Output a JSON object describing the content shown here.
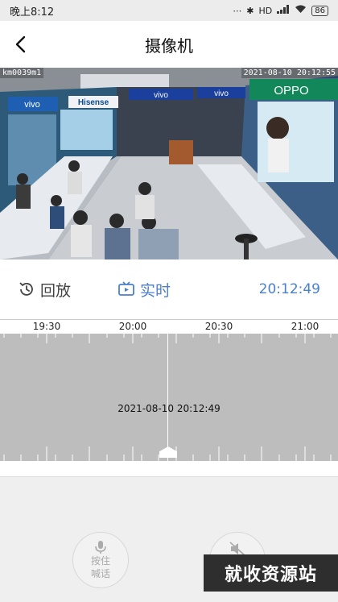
{
  "status_bar": {
    "time": "晚上8:12",
    "battery": "86",
    "network": "HD"
  },
  "header": {
    "title": "摄像机"
  },
  "video": {
    "osd_left": "km0039m1",
    "osd_right": "2021-08-10 20:12:55",
    "store_signs": [
      "vivo",
      "Hisense",
      "vivo",
      "vivo",
      "OPPO"
    ]
  },
  "controls": {
    "playback_label": "回放",
    "live_label": "实时",
    "current_time": "20:12:49"
  },
  "timeline": {
    "tick_labels": [
      "19:30",
      "20:00",
      "20:30",
      "21:00"
    ],
    "current_datetime": "2021-08-10 20:12:49"
  },
  "actions": {
    "talk_label_line1": "按住",
    "talk_label_line2": "喊话"
  },
  "watermark": "就收资源站",
  "colors": {
    "accent": "#4a7fd0",
    "timeline_bg": "#bdbdbd"
  }
}
